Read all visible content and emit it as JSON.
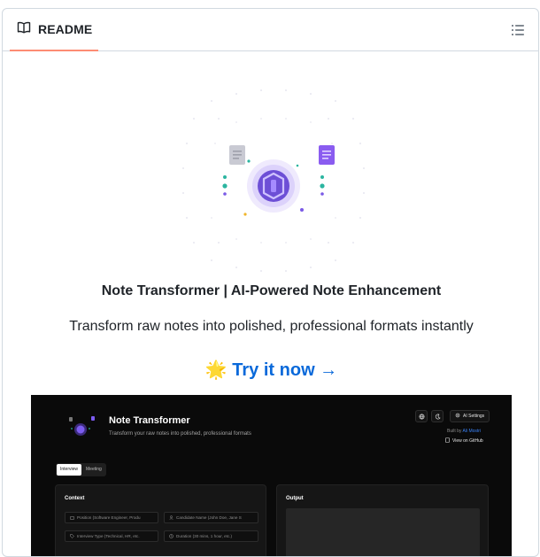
{
  "readme": {
    "tab_label": "README",
    "heading": "Note Transformer | AI-Powered Note Enhancement",
    "tagline": "Transform raw notes into polished, professional formats instantly",
    "cta_emoji": "🌟",
    "cta_label": "Try it now →"
  },
  "colors": {
    "link": "#0969da",
    "tab_underline": "#fd8c73",
    "hero_purple": "#6d4fd6",
    "hero_teal": "#2bb5a0"
  },
  "icons": [
    "book-icon",
    "list-unordered-icon",
    "globe-icon",
    "moon-icon",
    "gear-icon",
    "github-icon",
    "briefcase-icon",
    "user-icon",
    "tag-icon",
    "clock-icon"
  ],
  "app": {
    "title": "Note Transformer",
    "subtitle": "Transform your raw notes into polished, professional formats",
    "ai_settings_label": "AI Settings",
    "built_by_label": "Built by",
    "built_by_author": "Ali Mostri",
    "view_github_label": "View on GitHub",
    "tabs": [
      {
        "label": "Interview",
        "active": true
      },
      {
        "label": "Meeting",
        "active": false
      }
    ],
    "context": {
      "title": "Context",
      "fields": [
        {
          "placeholder": "Position (Software Engineer, Produ",
          "icon": "briefcase-icon"
        },
        {
          "placeholder": "Candidate Name (John Doe, Jane S",
          "icon": "user-icon"
        },
        {
          "placeholder": "Interview Type (Technical, HR, etc.",
          "icon": "tag-icon"
        },
        {
          "placeholder": "Duration (30 mins, 1 hour, etc.)",
          "icon": "clock-icon"
        }
      ]
    },
    "output": {
      "title": "Output"
    }
  }
}
